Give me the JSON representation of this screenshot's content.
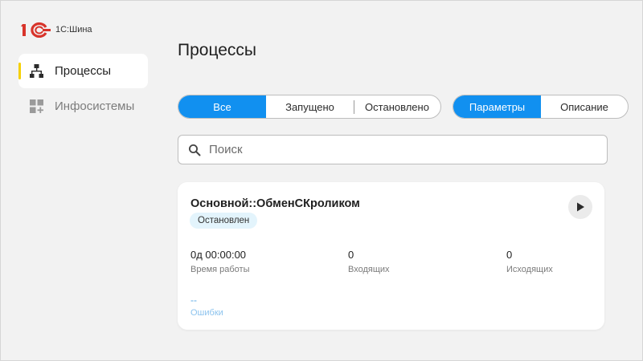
{
  "brand": {
    "name": "1С:Шина",
    "logo_icon": "1c-logo-icon"
  },
  "sidebar": {
    "items": [
      {
        "label": "Процессы",
        "icon": "hierarchy-icon",
        "active": true
      },
      {
        "label": "Инфосистемы",
        "icon": "apps-add-icon",
        "active": false
      }
    ]
  },
  "main": {
    "title": "Процессы",
    "filters": {
      "all": "Все",
      "running": "Запущено",
      "stopped": "Остановлено"
    },
    "views": {
      "params": "Параметры",
      "description": "Описание"
    },
    "search": {
      "placeholder": "Поиск",
      "value": ""
    },
    "card": {
      "title": "Основной::ОбменСКроликом",
      "status": "Остановлен",
      "stats": [
        {
          "value": "0д 00:00:00",
          "label": "Время работы"
        },
        {
          "value": "0",
          "label": "Входящих"
        },
        {
          "value": "0",
          "label": "Исходящих"
        }
      ],
      "errors": {
        "value": "--",
        "label": "Ошибки"
      }
    }
  },
  "colors": {
    "accent": "#1190f0",
    "marker": "#f5d000",
    "badge_bg": "#e3f4fc"
  }
}
